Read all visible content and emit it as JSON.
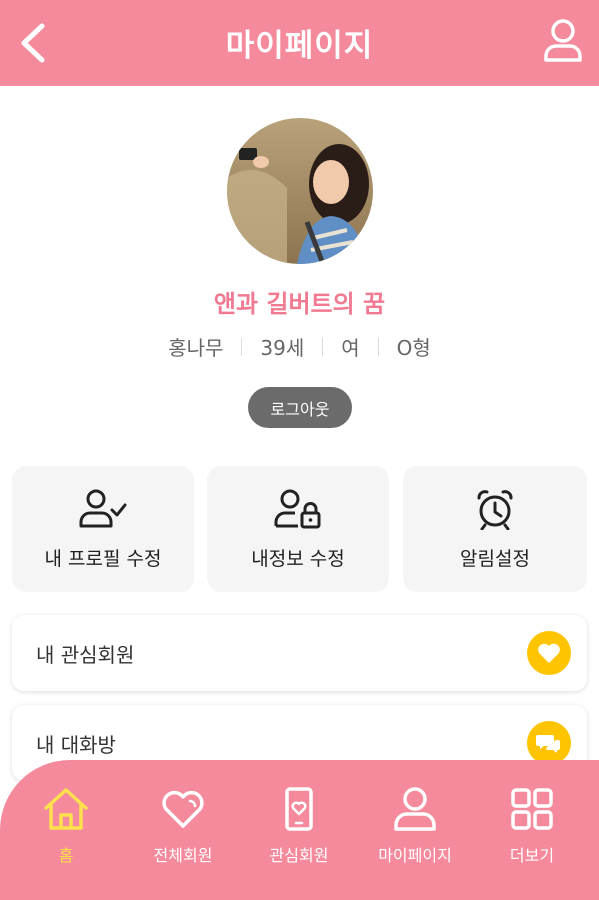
{
  "header": {
    "title": "마이페이지",
    "back_icon": "chevron-left-icon",
    "user_icon": "user-icon"
  },
  "profile": {
    "nickname": "앤과 길버트의 꿈",
    "name": "홍나무",
    "age": "39세",
    "gender": "여",
    "blood_type": "O형",
    "logout_label": "로그아웃"
  },
  "cards": [
    {
      "label": "내 프로필 수정",
      "icon": "user-check-icon"
    },
    {
      "label": "내정보 수정",
      "icon": "user-lock-icon"
    },
    {
      "label": "알림설정",
      "icon": "alarm-clock-icon"
    }
  ],
  "rows": [
    {
      "label": "내 관심회원",
      "icon": "heart-icon"
    },
    {
      "label": "내 대화방",
      "icon": "chat-icon"
    }
  ],
  "colors": {
    "primary": "#F48A9C",
    "accent": "#FFC400",
    "active_tab": "#FFE14D",
    "nickname": "#F07A92"
  },
  "tabs": [
    {
      "label": "홈",
      "icon": "home-icon",
      "active": true
    },
    {
      "label": "전체회원",
      "icon": "heart-icon",
      "active": false
    },
    {
      "label": "관심회원",
      "icon": "phone-heart-icon",
      "active": false
    },
    {
      "label": "마이페이지",
      "icon": "user-icon",
      "active": false
    },
    {
      "label": "더보기",
      "icon": "grid-icon",
      "active": false
    }
  ]
}
